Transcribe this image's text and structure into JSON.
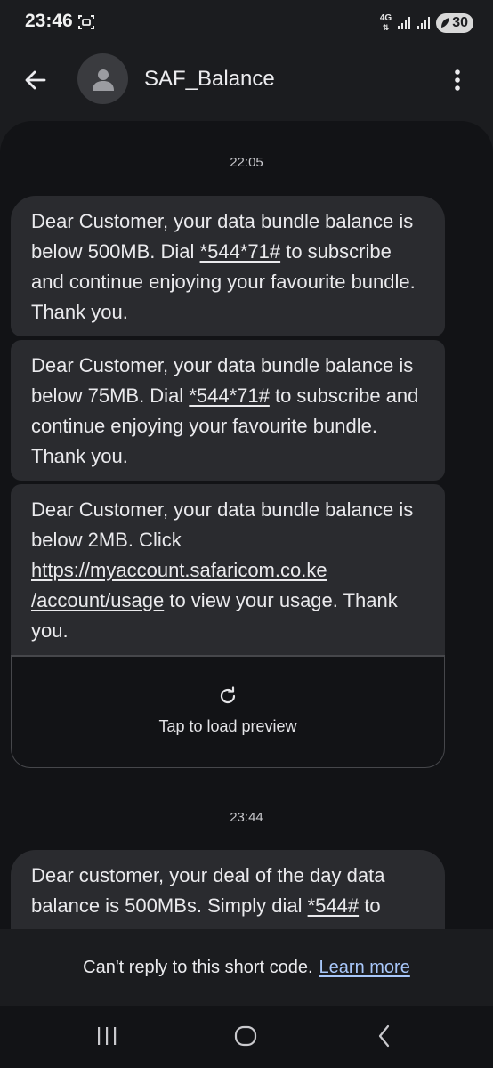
{
  "status_bar": {
    "time": "23:46",
    "network": "4G",
    "battery": "30"
  },
  "header": {
    "contact_name": "SAF_Balance",
    "back_icon": "arrow-left-icon",
    "more_icon": "more-vert-icon",
    "avatar_icon": "person-icon"
  },
  "conversation": {
    "groups": [
      {
        "time": "22:05",
        "messages": [
          {
            "pre": "Dear Customer, your data bundle balance is below 500MB. Dial ",
            "link": "*544*71#",
            "post": " to subscribe and continue enjoying your favourite bundle. Thank you."
          },
          {
            "pre": "Dear Customer, your data bundle balance is below 75MB. Dial ",
            "link": "*544*71#",
            "post": " to subscribe and continue enjoying your favourite bundle. Thank you."
          },
          {
            "pre": "Dear Customer, your data bundle balance is below 2MB. Click ",
            "link_line1": "https://myaccount.safaricom.co.ke",
            "link_line2": "/account/usage",
            "post": " to view your usage. Thank you."
          }
        ],
        "preview": {
          "label": "Tap to load preview",
          "icon": "refresh-icon"
        }
      },
      {
        "time": "23:44",
        "messages": [
          {
            "pre": "Dear customer, your deal of the day data balance is 500MBs. Simply dial ",
            "link": "*544#",
            "post": " to"
          }
        ]
      }
    ]
  },
  "footer": {
    "notice": "Can't reply to this short code.",
    "learn_more": "Learn more"
  },
  "nav": {
    "recents_icon": "recents-icon",
    "home_icon": "home-icon",
    "back_icon": "back-icon"
  },
  "colors": {
    "background": "#1b1c1f",
    "conversation_bg": "#121316",
    "bubble": "#2a2b2f",
    "link": "#a8c7fa"
  }
}
